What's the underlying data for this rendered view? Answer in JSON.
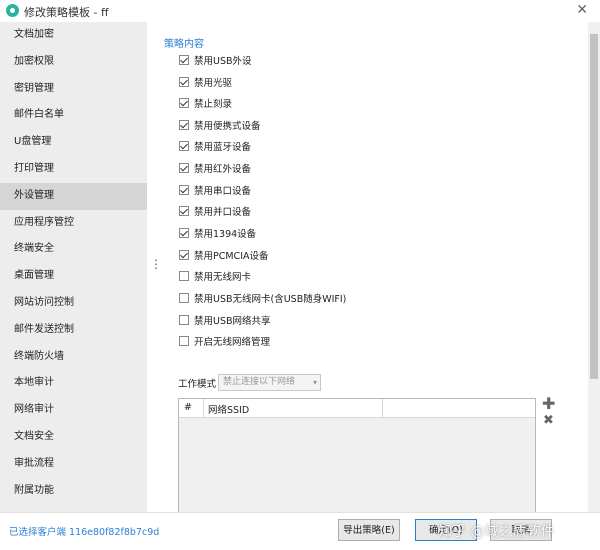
{
  "window": {
    "title": "修改策略模板 - ff",
    "close_symbol": "✕"
  },
  "sidebar": {
    "active_index": 6,
    "items": [
      {
        "label": "文档加密"
      },
      {
        "label": "加密权限"
      },
      {
        "label": "密钥管理"
      },
      {
        "label": "邮件白名单"
      },
      {
        "label": "U盘管理"
      },
      {
        "label": "打印管理"
      },
      {
        "label": "外设管理"
      },
      {
        "label": "应用程序管控"
      },
      {
        "label": "终端安全"
      },
      {
        "label": "桌面管理"
      },
      {
        "label": "网站访问控制"
      },
      {
        "label": "邮件发送控制"
      },
      {
        "label": "终端防火墙"
      },
      {
        "label": "本地审计"
      },
      {
        "label": "网络审计"
      },
      {
        "label": "文档安全"
      },
      {
        "label": "审批流程"
      },
      {
        "label": "附属功能"
      }
    ]
  },
  "divider_symbol": "⋮",
  "content": {
    "section_title": "策略内容",
    "options": [
      {
        "label": "禁用USB外设",
        "checked": true
      },
      {
        "label": "禁用光驱",
        "checked": true
      },
      {
        "label": "禁止刻录",
        "checked": true
      },
      {
        "label": "禁用便携式设备",
        "checked": true
      },
      {
        "label": "禁用蓝牙设备",
        "checked": true
      },
      {
        "label": "禁用红外设备",
        "checked": true
      },
      {
        "label": "禁用串口设备",
        "checked": true
      },
      {
        "label": "禁用并口设备",
        "checked": true
      },
      {
        "label": "禁用1394设备",
        "checked": true
      },
      {
        "label": "禁用PCMCIA设备",
        "checked": true
      },
      {
        "label": "禁用无线网卡",
        "checked": false
      },
      {
        "label": "禁用USB无线网卡(含USB随身WIFI)",
        "checked": false
      },
      {
        "label": "禁用USB网络共享",
        "checked": false
      },
      {
        "label": "开启无线网络管理",
        "checked": false
      }
    ],
    "work_mode": {
      "label": "工作模式",
      "value": "禁止连接以下网络",
      "arrow": "▾"
    },
    "ssid_table": {
      "col_num": "#",
      "col_ssid": "网络SSID",
      "add_symbol": "✚",
      "remove_symbol": "✖"
    }
  },
  "footer": {
    "client_info": "已选择客户端 116e80f82f8b7c9d",
    "export_label": "导出策略(E)",
    "ok_label": "确定(O)",
    "cancel_label": "取消",
    "watermark": "知乎 @域之盾软件"
  }
}
